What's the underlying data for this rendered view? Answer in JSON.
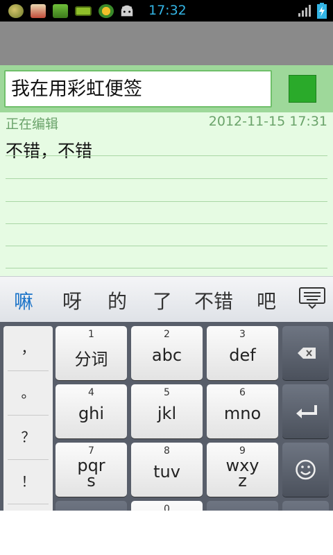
{
  "status_bar": {
    "time": "17:32",
    "left_icons": [
      "notification-icon",
      "gallery-icon",
      "money-icon",
      "battery-saver-icon",
      "app-icon",
      "android-icon"
    ],
    "right_icons": [
      "signal-icon",
      "battery-charging-icon"
    ],
    "accent": "#33b5e5"
  },
  "note": {
    "title": "我在用彩虹便签",
    "color_hex": "#2aaa2a",
    "status_label": "正在编辑",
    "timestamp": "2012-11-15 17:31",
    "body": "不错，不错"
  },
  "ime": {
    "candidates": [
      "嘛",
      "呀",
      "的",
      "了",
      "不错",
      "吧"
    ],
    "punct": [
      "，",
      "。",
      "？",
      "！"
    ],
    "keys": [
      {
        "num": "1",
        "label": "分词"
      },
      {
        "num": "2",
        "label": "abc"
      },
      {
        "num": "3",
        "label": "def"
      },
      {
        "num": "4",
        "label": "ghi"
      },
      {
        "num": "5",
        "label": "jkl"
      },
      {
        "num": "6",
        "label": "mno"
      },
      {
        "num": "7",
        "label": "pqr\ns"
      },
      {
        "num": "8",
        "label": "tuv"
      },
      {
        "num": "9",
        "label": "wxy\nz"
      },
      {
        "num": "0",
        "label": ""
      }
    ]
  }
}
